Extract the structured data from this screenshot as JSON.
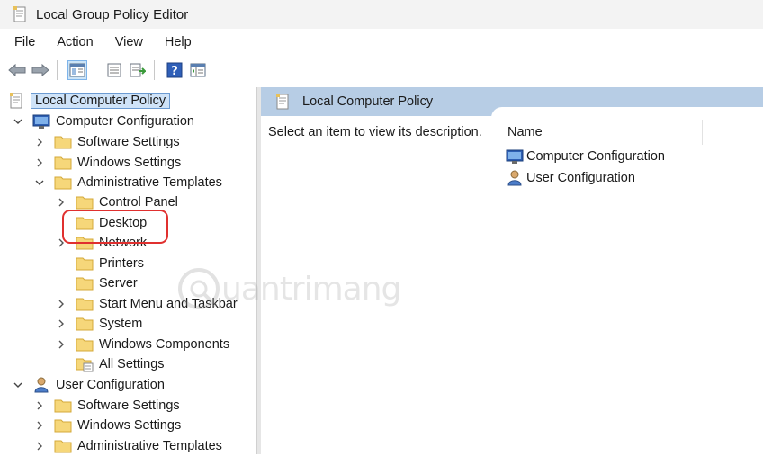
{
  "window": {
    "title": "Local Group Policy Editor"
  },
  "menu": {
    "items": [
      "File",
      "Action",
      "View",
      "Help"
    ]
  },
  "toolbar": {
    "icons": [
      "back-arrow-icon",
      "forward-arrow-icon",
      "show-hide-tree-icon",
      "properties-icon",
      "export-list-icon",
      "help-icon",
      "extended-view-icon"
    ]
  },
  "tree": {
    "root": "Local Computer Policy",
    "computer_configuration": "Computer Configuration",
    "cc_software_settings": "Software Settings",
    "cc_windows_settings": "Windows Settings",
    "cc_administrative_templates": "Administrative Templates",
    "control_panel": "Control Panel",
    "desktop": "Desktop",
    "network": "Network",
    "printers": "Printers",
    "server": "Server",
    "start_menu_taskbar": "Start Menu and Taskbar",
    "system": "System",
    "windows_components": "Windows Components",
    "all_settings": "All Settings",
    "user_configuration": "User Configuration",
    "uc_software_settings": "Software Settings",
    "uc_windows_settings": "Windows Settings",
    "uc_administrative_templates": "Administrative Templates"
  },
  "right_pane": {
    "header_title": "Local Computer Policy",
    "description": "Select an item to view its description.",
    "column_name": "Name",
    "items": [
      "Computer Configuration",
      "User Configuration"
    ]
  },
  "watermark": {
    "text": "uantrimang"
  },
  "colors": {
    "header_bg": "#b7cde5",
    "selection_bg": "#cfe3f8",
    "highlight_ring": "#e0302f",
    "folder": "#f6d77a"
  }
}
